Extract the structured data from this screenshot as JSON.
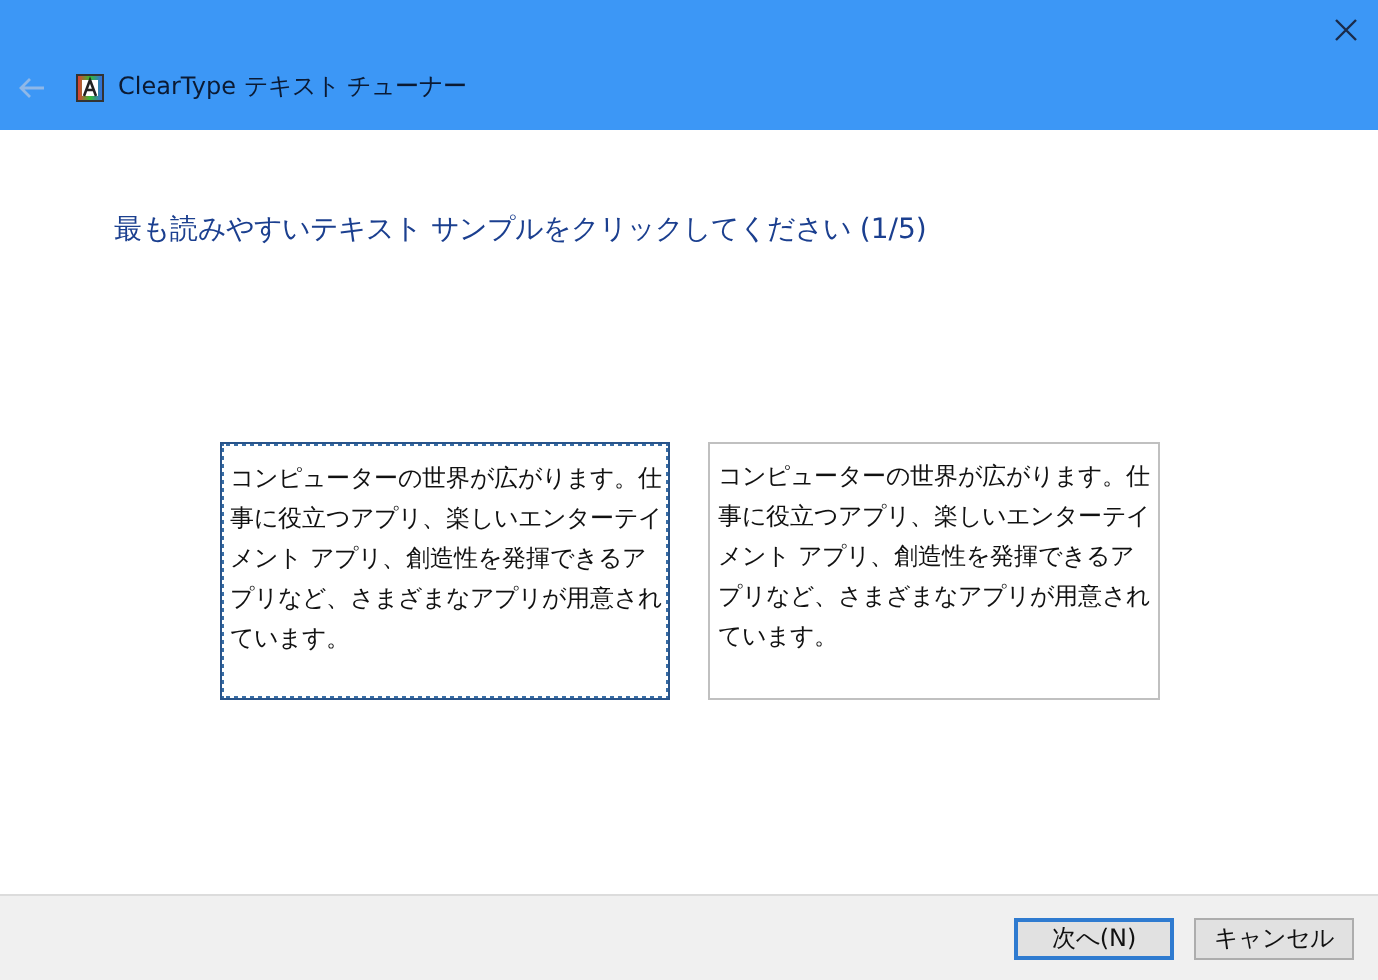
{
  "window": {
    "title": "ClearType テキスト チューナー"
  },
  "heading": "最も読みやすいテキスト サンプルをクリックしてください (1/5)",
  "samples": [
    {
      "text": "コンピューターの世界が広がります。仕事に役立つアプリ、楽しいエンターテイメント アプリ、創造性を発揮できるアプリなど、さまざまなアプリが用意されています。",
      "selected": true
    },
    {
      "text": "コンピューターの世界が広がります。仕事に役立つアプリ、楽しいエンターテイメント アプリ、創造性を発揮できるアプリなど、さまざまなアプリが用意されています。",
      "selected": false
    }
  ],
  "buttons": [
    {
      "label": "次へ(N)",
      "default": true
    },
    {
      "label": "キャンセル",
      "default": false
    }
  ]
}
